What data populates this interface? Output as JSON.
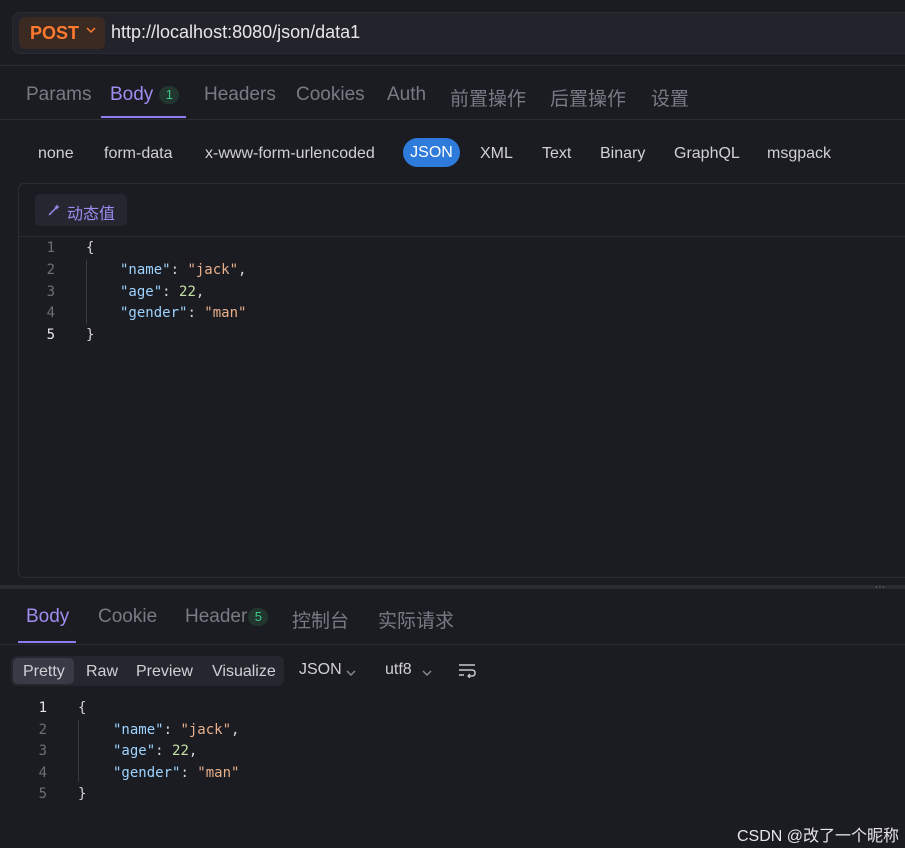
{
  "request": {
    "method": "POST",
    "url": "http://localhost:8080/json/data1",
    "tabs": [
      {
        "label": "Params"
      },
      {
        "label": "Body",
        "badge": "1"
      },
      {
        "label": "Headers"
      },
      {
        "label": "Cookies"
      },
      {
        "label": "Auth"
      },
      {
        "label": "前置操作"
      },
      {
        "label": "后置操作"
      },
      {
        "label": "设置"
      }
    ],
    "active_tab": "Body",
    "body_types": [
      "none",
      "form-data",
      "x-www-form-urlencoded",
      "JSON",
      "XML",
      "Text",
      "Binary",
      "GraphQL",
      "msgpack"
    ],
    "active_body_type": "JSON",
    "dynamic_value_label": "动态值",
    "editor_lines": [
      {
        "num": "1",
        "text": "{"
      },
      {
        "num": "2",
        "key": "\"name\"",
        "value": "\"jack\"",
        "trail": ","
      },
      {
        "num": "3",
        "key": "\"age\"",
        "value": "22",
        "trail": ","
      },
      {
        "num": "4",
        "key": "\"gender\"",
        "value": "\"man\"",
        "trail": ""
      },
      {
        "num": "5",
        "text": "}"
      }
    ]
  },
  "response": {
    "tabs": [
      {
        "label": "Body"
      },
      {
        "label": "Cookie"
      },
      {
        "label": "Header",
        "badge": "5"
      },
      {
        "label": "控制台"
      },
      {
        "label": "实际请求"
      }
    ],
    "active_tab": "Body",
    "view_modes": [
      "Pretty",
      "Raw",
      "Preview",
      "Visualize"
    ],
    "active_view_mode": "Pretty",
    "format": "JSON",
    "encoding": "utf8",
    "lines": [
      {
        "num": "1",
        "text": "{"
      },
      {
        "num": "2",
        "key": "\"name\"",
        "value": "\"jack\"",
        "trail": ","
      },
      {
        "num": "3",
        "key": "\"age\"",
        "value": "22",
        "trail": ","
      },
      {
        "num": "4",
        "key": "\"gender\"",
        "value": "\"man\"",
        "trail": ""
      },
      {
        "num": "5",
        "text": "}"
      }
    ]
  },
  "watermark": "CSDN @改了一个昵称",
  "colors": {
    "accent": "#9f8df0",
    "method": "#ff7a2f",
    "json_pill": "#2f7bdc",
    "badge_green": "#3bc98a"
  }
}
